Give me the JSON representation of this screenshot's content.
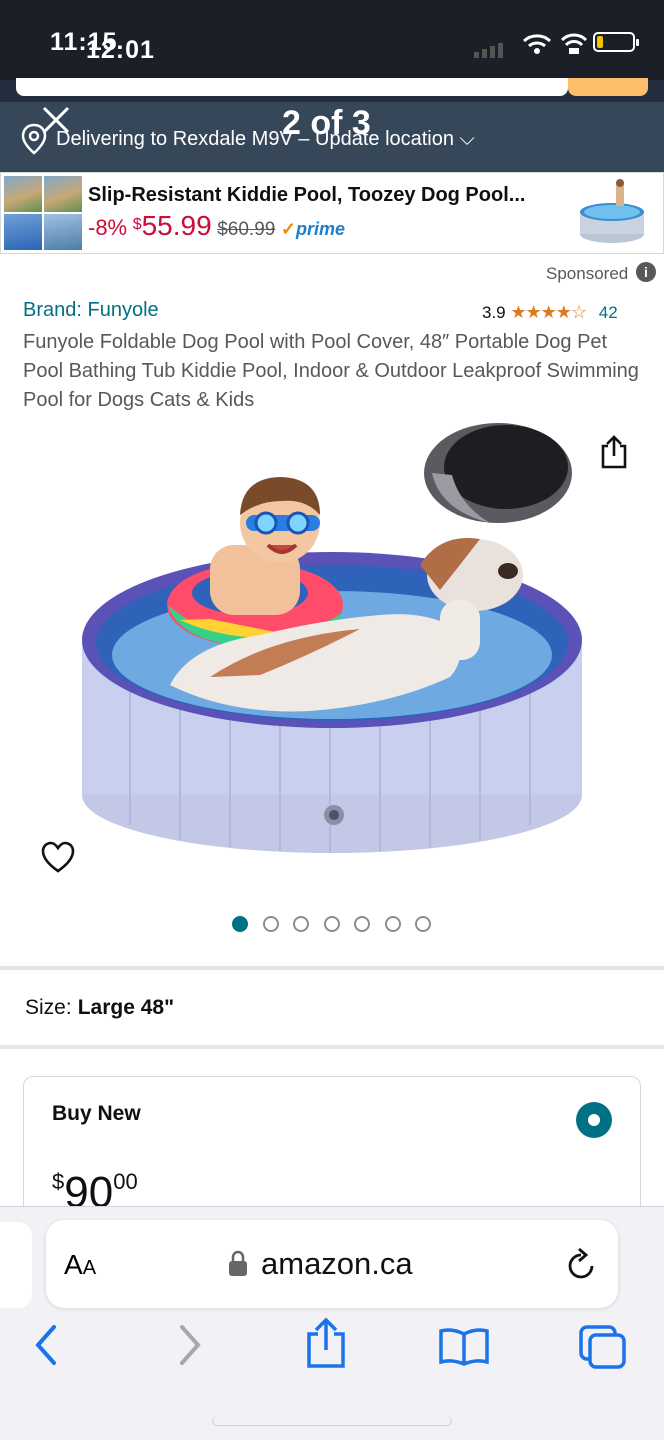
{
  "status_bar": {
    "time_back": "11:15",
    "time_front": "12:01"
  },
  "overlay": {
    "counter": "2 of 3"
  },
  "header": {
    "delivery_text": "Delivering to Rexdale M9V – Update location ⌵"
  },
  "sponsored_banner": {
    "title": "Slip-Resistant Kiddie Pool, Toozey Dog Pool...",
    "discount": "-8%",
    "currency": "$",
    "price": "55.99",
    "was_price": "$60.99",
    "prime_check": "✓",
    "prime_label": "prime"
  },
  "sponsored": {
    "label": "Sponsored",
    "info_icon": "i"
  },
  "product": {
    "brand": "Brand: Funyole",
    "rating_value": "3.9",
    "stars": "★★★★☆",
    "rating_count": "42",
    "title": "Funyole Foldable Dog Pool with Pool Cover, 48″ Portable Dog Pet Pool Bathing Tub Kiddie Pool, Indoor & Outdoor Leakproof Swimming Pool for Dogs Cats & Kids",
    "image_count": 7,
    "active_image": 1
  },
  "size": {
    "label": "Size:",
    "value": "Large 48\""
  },
  "buy_box": {
    "label": "Buy New",
    "currency": "$",
    "whole": "90",
    "cents": "00"
  },
  "browser": {
    "aa_large": "A",
    "aa_small": "A",
    "domain": "amazon.ca"
  },
  "colors": {
    "amazon_dark": "#232f3e",
    "amazon_nav": "#37475a",
    "link_teal": "#007185",
    "deal_red": "#cc0c39",
    "star_orange": "#de7921",
    "ios_blue": "#007aff"
  },
  "icons": [
    "close-icon",
    "location-pin-icon",
    "share-icon",
    "heart-icon",
    "info-icon",
    "lock-icon",
    "reload-icon",
    "back-icon",
    "forward-icon",
    "bookmarks-icon",
    "tabs-icon"
  ]
}
